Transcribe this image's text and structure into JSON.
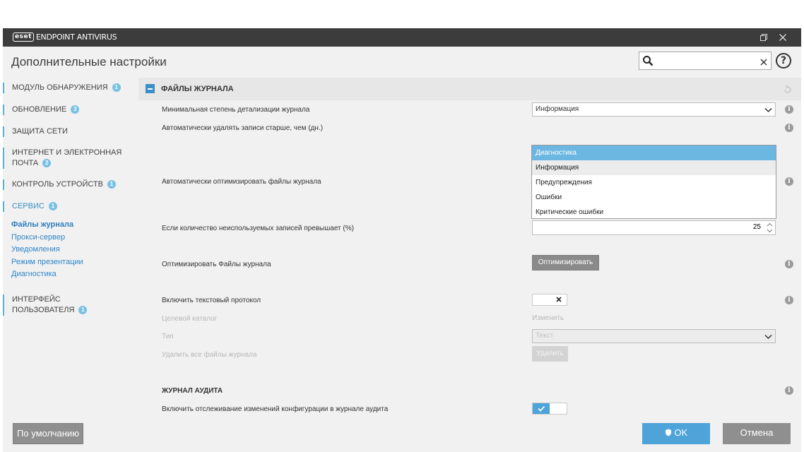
{
  "window": {
    "logo": "eset",
    "product": "ENDPOINT ANTIVIRUS",
    "restore_icon": "restore-window-icon",
    "close_icon": "close-icon"
  },
  "header": {
    "title": "Дополнительные настройки",
    "search": {
      "value": "",
      "placeholder": ""
    },
    "help_label": "?"
  },
  "sidebar": {
    "items": [
      {
        "label": "МОДУЛЬ ОБНАРУЖЕНИЯ",
        "badge": "1"
      },
      {
        "label": "ОБНОВЛЕНИЕ",
        "badge": "3"
      },
      {
        "label": "ЗАЩИТА СЕТИ"
      },
      {
        "label_line1": "ИНТЕРНЕТ И ЭЛЕКТРОННАЯ",
        "label_line2": "ПОЧТА",
        "badge": "2"
      },
      {
        "label": "КОНТРОЛЬ УСТРОЙСТВ",
        "badge": "1"
      },
      {
        "label": "СЕРВИС",
        "badge": "1"
      },
      {
        "label_line1": "ИНТЕРФЕЙС",
        "label_line2": "ПОЛЬЗОВАТЕЛЯ",
        "badge": "1"
      }
    ],
    "subitems": [
      "Файлы журнала",
      "Прокси-сервер",
      "Уведомления",
      "Режим презентации",
      "Диагностика"
    ]
  },
  "log_files": {
    "section_title": "ФАЙЛЫ ЖУРНАЛА",
    "min_verbosity": {
      "label": "Минимальная степень детализации журнала",
      "selected": "Информация",
      "options": [
        "Диагностика",
        "Информация",
        "Предупреждения",
        "Ошибки",
        "Критические ошибки"
      ]
    },
    "auto_delete_label": "Автоматически удалять записи старше, чем (дн.)",
    "auto_optimize_label": "Автоматически оптимизировать файлы журнала",
    "unused_threshold": {
      "label": "Если количество неиспользуемых записей превышает (%)",
      "value": "25"
    },
    "optimize": {
      "label": "Оптимизировать Файлы журнала",
      "button": "Оптимизировать"
    },
    "text_protocol": {
      "label": "Включить текстовый протокол",
      "toggle_symbol": "✕"
    },
    "target_dir": {
      "label": "Целевой каталог",
      "link": "Изменить"
    },
    "type": {
      "label": "Тип",
      "selected": "Текст"
    },
    "delete_all": {
      "label": "Удалить все файлы журнала",
      "button": "Удалить"
    }
  },
  "audit_log": {
    "section_title": "ЖУРНАЛ АУДИТА",
    "tracking": {
      "label": "Включить отслеживание изменений конфигурации в журнале аудита",
      "toggle_symbol": "✓"
    }
  },
  "footer": {
    "default_button": "По умолчанию",
    "ok_button": "OK",
    "cancel_button": "Отмена"
  },
  "colors": {
    "accent": "#3a8fc6",
    "highlight": "#6cb7e2",
    "titlebar": "#3c3c3c",
    "ok": "#4ea3d9"
  }
}
